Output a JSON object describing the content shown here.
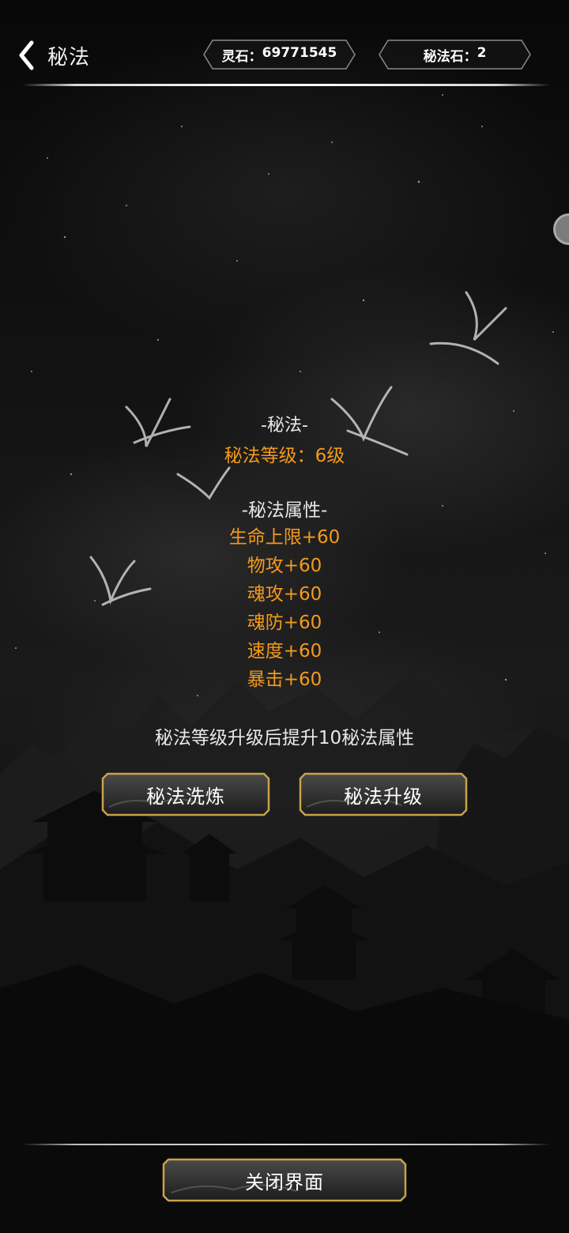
{
  "header": {
    "title": "秘法",
    "resources": [
      {
        "label": "灵石：",
        "value": "69771545"
      },
      {
        "label": "秘法石：",
        "value": "2"
      }
    ]
  },
  "panel": {
    "section_title": "-秘法-",
    "level_text": "秘法等级：6级",
    "attributes_title": "-秘法属性-",
    "attributes": [
      "生命上限+60",
      "物攻+60",
      "魂攻+60",
      "魂防+60",
      "速度+60",
      "暴击+60"
    ],
    "tip": "秘法等级升级后提升10秘法属性"
  },
  "buttons": {
    "refine": "秘法洗炼",
    "upgrade": "秘法升级",
    "close": "关闭界面"
  },
  "colors": {
    "accent_orange": "#f39a1c",
    "button_border": "#c9a24a"
  }
}
